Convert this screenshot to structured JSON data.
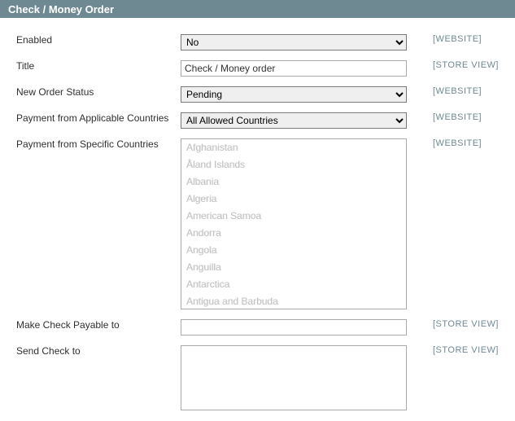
{
  "section": {
    "title": "Check / Money Order"
  },
  "fields": {
    "enabled": {
      "label": "Enabled",
      "value": "No",
      "scope": "[WEBSITE]"
    },
    "title": {
      "label": "Title",
      "value": "Check / Money order",
      "scope": "[STORE VIEW]"
    },
    "order_status": {
      "label": "New Order Status",
      "value": "Pending",
      "scope": "[WEBSITE]"
    },
    "allowspecific": {
      "label": "Payment from Applicable Countries",
      "value": "All Allowed Countries",
      "scope": "[WEBSITE]"
    },
    "specificcountry": {
      "label": "Payment from Specific Countries",
      "options": [
        "Afghanistan",
        "Åland Islands",
        "Albania",
        "Algeria",
        "American Samoa",
        "Andorra",
        "Angola",
        "Anguilla",
        "Antarctica",
        "Antigua and Barbuda"
      ],
      "scope": "[WEBSITE]"
    },
    "payable_to": {
      "label": "Make Check Payable to",
      "value": "",
      "scope": "[STORE VIEW]"
    },
    "mailing_address": {
      "label": "Send Check to",
      "value": "",
      "scope": "[STORE VIEW]"
    }
  }
}
